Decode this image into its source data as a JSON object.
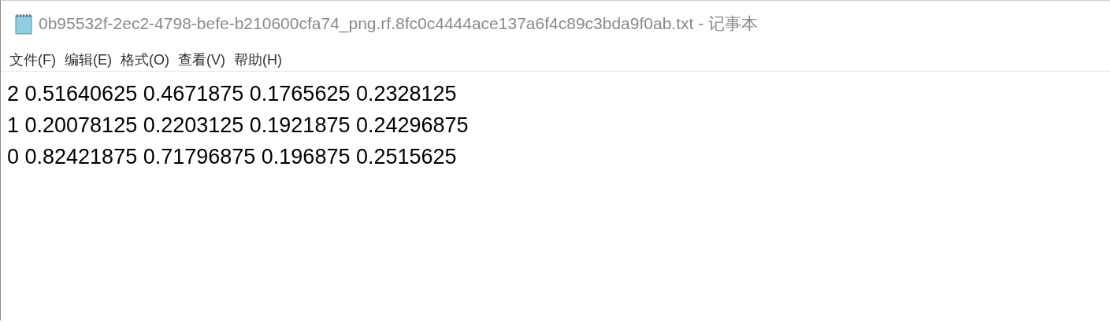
{
  "window": {
    "title": "0b95532f-2ec2-4798-befe-b210600cfa74_png.rf.8fc0c4444ace137a6f4c89c3bda9f0ab.txt - 记事本"
  },
  "menu": [
    "文件(F)",
    "编辑(E)",
    "格式(O)",
    "查看(V)",
    "帮助(H)"
  ],
  "editor": {
    "lines": [
      "2 0.51640625 0.4671875 0.1765625 0.2328125",
      "1 0.20078125 0.2203125 0.1921875 0.24296875",
      "0 0.82421875 0.71796875 0.196875 0.2515625"
    ]
  }
}
